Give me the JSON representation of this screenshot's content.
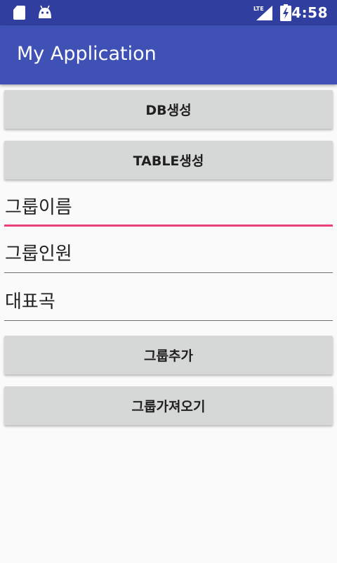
{
  "status_bar": {
    "time": "4:58",
    "icons": [
      "sd-card-icon",
      "android-debug-icon",
      "lte-signal-icon",
      "battery-charging-icon"
    ]
  },
  "app_bar": {
    "title": "My Application",
    "color": "#3f51b5",
    "status_color": "#303f9f"
  },
  "buttons": {
    "create_db": "DB생성",
    "create_table": "TABLE생성",
    "add_group": "그룹추가",
    "get_groups": "그룹가져오기"
  },
  "fields": {
    "group_name": {
      "placeholder": "그룹이름",
      "value": ""
    },
    "group_members": {
      "placeholder": "그룹인원",
      "value": ""
    },
    "representative_song": {
      "placeholder": "대표곡",
      "value": ""
    }
  },
  "accent_color": "#e8407c"
}
